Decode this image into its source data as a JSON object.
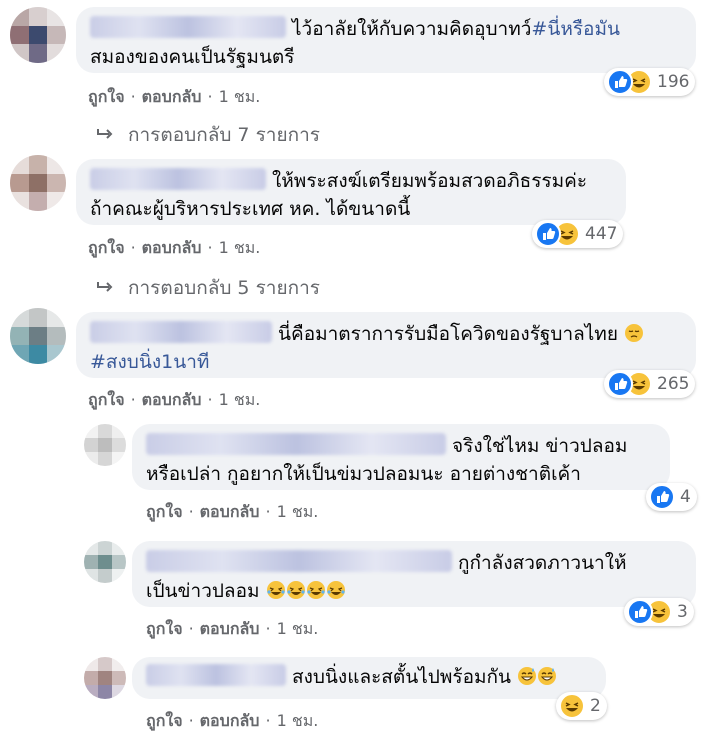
{
  "comments": [
    {
      "text": "ไว้อาลัยให้กับความคิดอุบาทว์",
      "hashtag": "#นี่หรือมัน",
      "text2": "สมองของคนเป็นรัฐมนตรี",
      "reaction_count": "196",
      "like_label": "ถูกใจ",
      "reply_label": "ตอบกลับ",
      "time": "1 ชม.",
      "replies_link": "การตอบกลับ 7 รายการ"
    },
    {
      "text": "ให้พระสงฆ์เตรียมพร้อมสวดอภิธรรมค่ะ",
      "text2": "ถ้าคณะผู้บริหารประเทศ หค. ได้ขนาดนี้",
      "reaction_count": "447",
      "like_label": "ถูกใจ",
      "reply_label": "ตอบกลับ",
      "time": "1 ชม.",
      "replies_link": "การตอบกลับ 5 รายการ"
    },
    {
      "text": "นี่คือมาตราการรับมือโควิดของรัฐบาลไทย",
      "hashtag": "#สงบนิ่ง1นาที",
      "reaction_count": "265",
      "like_label": "ถูกใจ",
      "reply_label": "ตอบกลับ",
      "time": "1 ชม."
    }
  ],
  "replies": [
    {
      "text": "จริงใช่ไหม ข่าวปลอม",
      "text2": "หรือเปล่า กูอยากให้เป็นข่มวปลอมนะ อายต่างชาติเค้า",
      "reaction_count": "4",
      "like_label": "ถูกใจ",
      "reply_label": "ตอบกลับ",
      "time": "1 ชม."
    },
    {
      "text": "กูกำลังสวดภาวนาให้",
      "text2": "เป็นข่าวปลอม",
      "reaction_count": "3",
      "like_label": "ถูกใจ",
      "reply_label": "ตอบกลับ",
      "time": "1 ชม."
    },
    {
      "text": "สงบนิ่งและสตั้นไปพร้อมกัน",
      "reaction_count": "2",
      "like_label": "ถูกใจ",
      "reply_label": "ตอบกลับ",
      "time": "1 ชม."
    }
  ],
  "colors": {
    "bubble": "#f0f2f5",
    "meta": "#65676b",
    "hashtag": "#385898",
    "like": "#1877f2",
    "haha": "#f7c33b"
  },
  "icons": [
    "like-reaction-icon",
    "haha-reaction-icon",
    "reply-arrow-icon",
    "pensive-emoji-icon",
    "rofl-emoji-icon",
    "grin-sweat-emoji-icon"
  ]
}
